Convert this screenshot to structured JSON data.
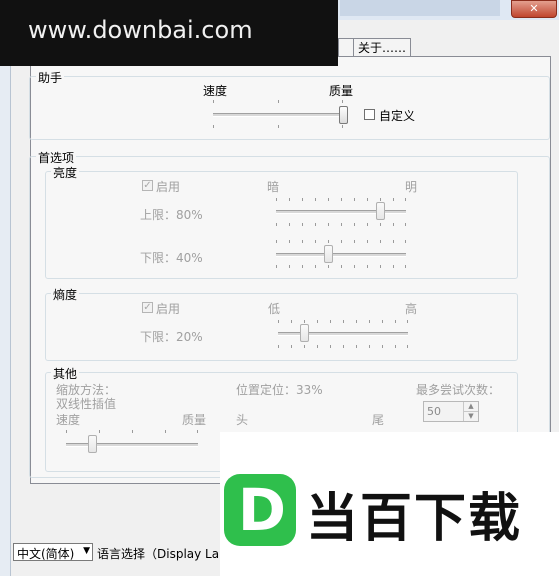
{
  "window": {
    "close_glyph": "✕"
  },
  "tabs": [
    {
      "label": ""
    },
    {
      "label": "关于……"
    }
  ],
  "helper": {
    "legend": "助手",
    "speed_label": "速度",
    "quality_label": "质量",
    "custom_label": "自定义",
    "slider_value": 1.0
  },
  "prefs": {
    "legend": "首选项",
    "brightness": {
      "legend": "亮度",
      "enable_label": "启用",
      "enable_checked": true,
      "dark_label": "暗",
      "bright_label": "明",
      "upper_label": "上限：80%",
      "lower_label": "下限：40%",
      "upper_value": 0.8,
      "lower_value": 0.4
    },
    "entropy": {
      "legend": "熵度",
      "enable_label": "启用",
      "enable_checked": true,
      "low_label": "低",
      "high_label": "高",
      "lower_label": "下限：20%",
      "lower_value": 0.2
    },
    "other": {
      "legend": "其他",
      "scale_method_label": "缩放方法：",
      "scale_method_value": "双线性插值",
      "speed_label": "速度",
      "quality_label": "质量",
      "position_label": "位置定位：33%",
      "head_label": "头",
      "tail_label": "尾",
      "max_attempts_label": "最多尝试次数：",
      "max_attempts_value": "50",
      "scale_slider_value": 0.2
    }
  },
  "language": {
    "selected": "中文(简体)",
    "label": "语言选择（Display Langu"
  },
  "overlays": {
    "watermark_text": "www.downbai.com",
    "logo_letter": "D",
    "logo_text": "当百下载",
    "logo_color": "#2fbf4c"
  }
}
